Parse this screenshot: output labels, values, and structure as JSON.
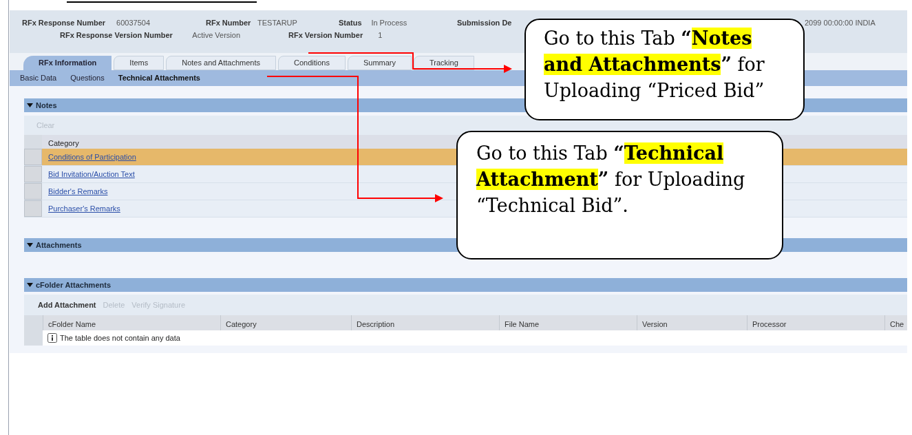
{
  "header": {
    "fields": [
      {
        "label": "RFx Response Number",
        "value": "60037504"
      },
      {
        "label": "RFx Number",
        "value": "TESTARUP"
      },
      {
        "label": "Status",
        "value": "In Process"
      },
      {
        "label": "Submission De",
        "value": "2099 00:00:00 INDIA"
      },
      {
        "label": "RFx Response Version Number",
        "value": "Active Version"
      },
      {
        "label": "RFx Version Number",
        "value": "1"
      }
    ]
  },
  "tabs": [
    {
      "label": "RFx Information",
      "selected": true
    },
    {
      "label": "Items",
      "selected": false
    },
    {
      "label": "Notes and Attachments",
      "selected": false
    },
    {
      "label": "Conditions",
      "selected": false
    },
    {
      "label": "Summary",
      "selected": false
    },
    {
      "label": "Tracking",
      "selected": false
    }
  ],
  "subtabs": [
    {
      "label": "Basic Data",
      "selected": false
    },
    {
      "label": "Questions",
      "selected": false
    },
    {
      "label": "Technical Attachments",
      "selected": true
    }
  ],
  "notes": {
    "title": "Notes",
    "toolbar": [
      {
        "label": "Clear",
        "disabled": true
      }
    ],
    "column": "Category",
    "rows": [
      {
        "label": "Conditions of Participation",
        "selected": true
      },
      {
        "label": "Bid Invitation/Auction Text",
        "selected": false
      },
      {
        "label": "Bidder's Remarks",
        "selected": false
      },
      {
        "label": "Purchaser's Remarks",
        "selected": false
      }
    ]
  },
  "attachments": {
    "title": "Attachments"
  },
  "cfolder": {
    "title": "cFolder Attachments",
    "toolbar": [
      {
        "label": "Add Attachment",
        "disabled": false
      },
      {
        "label": "Delete",
        "disabled": true
      },
      {
        "label": "Verify Signature",
        "disabled": true
      }
    ],
    "columns": [
      "cFolder Name",
      "Category",
      "Description",
      "File Name",
      "Version",
      "Processor",
      "Che"
    ],
    "empty_message": "The table does not contain any data"
  },
  "callouts": [
    {
      "segments": [
        {
          "text": "Go to this Tab ",
          "kind": "plain"
        },
        {
          "text": "“",
          "kind": "bold"
        },
        {
          "text": "Notes and Attachments",
          "kind": "highlight"
        },
        {
          "text": "”",
          "kind": "bold"
        },
        {
          "text": " for Uploading “Priced Bid”",
          "kind": "plain"
        }
      ]
    },
    {
      "segments": [
        {
          "text": "Go to this Tab ",
          "kind": "plain"
        },
        {
          "text": "“",
          "kind": "bold"
        },
        {
          "text": "Technical Attachment",
          "kind": "highlight"
        },
        {
          "text": "”",
          "kind": "bold"
        },
        {
          "text": " for Uploading “Technical Bid”.",
          "kind": "plain"
        }
      ]
    }
  ]
}
